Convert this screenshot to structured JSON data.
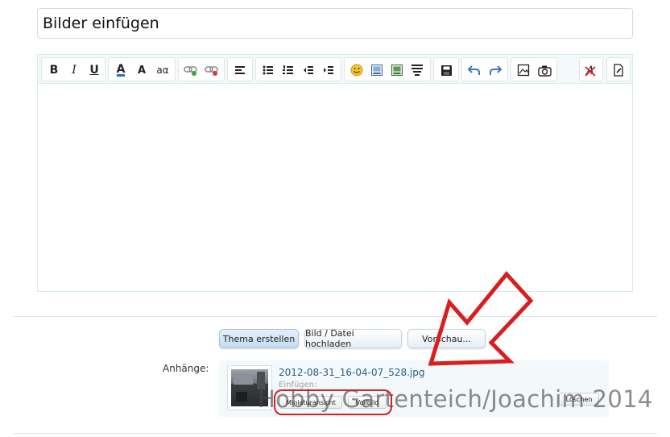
{
  "title_input": {
    "value": "Bilder einfügen"
  },
  "toolbar": {
    "bold_label": "B",
    "italic_label": "I",
    "underline_label": "U",
    "font_color_label": "A",
    "font_size_label": "A",
    "font_family_label": "aα",
    "buttons": [
      "bold",
      "italic",
      "underline",
      "font-color",
      "font-size",
      "font-family",
      "link",
      "unlink",
      "align",
      "unordered-list",
      "ordered-list",
      "outdent",
      "indent",
      "smilies",
      "image",
      "media",
      "code",
      "save",
      "undo",
      "redo",
      "insert-image",
      "camera",
      "remove-format",
      "draft"
    ]
  },
  "actions": {
    "create_thread": "Thema erstellen",
    "upload_file": "Bild / Datei hochladen",
    "preview": "Vorschau..."
  },
  "attachments": {
    "label": "Anhänge:",
    "filename": "2012-08-31_16-04-07_528.jpg",
    "insert_label": "Einfügen:",
    "thumbnail_button": "Miniaturansicht",
    "fullsize_button": "Vollbild",
    "delete_button": "Löschen"
  },
  "watermark": "Hobby Gartenteich/Joachim 2014",
  "colors": {
    "annotation_red": "#d71f1f",
    "link_blue": "#2b5f86",
    "primary_button": "#c4dcf1"
  }
}
